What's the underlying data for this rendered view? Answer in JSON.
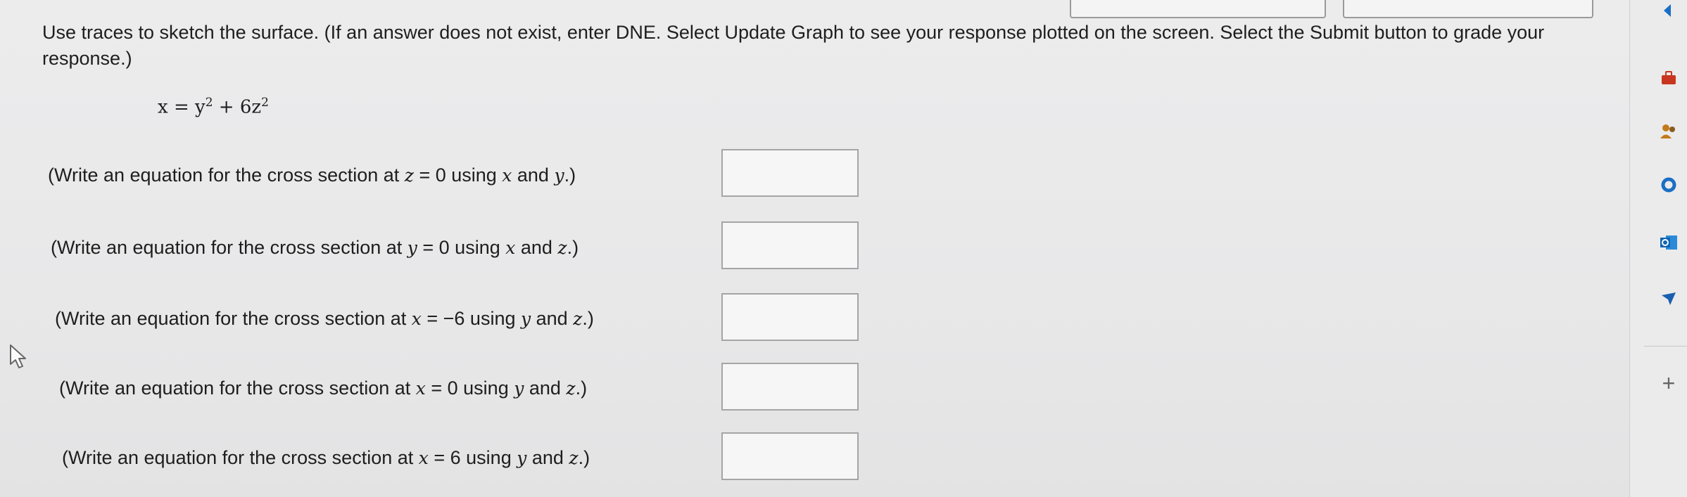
{
  "instructions": "Use traces to sketch the surface. (If an answer does not exist, enter DNE. Select Update Graph to see your response plotted on the screen. Select the Submit button to grade your response.)",
  "equation": {
    "lhs": "x",
    "eq": "=",
    "y": "y",
    "exp2": "2",
    "plus": "+",
    "coef": "6z",
    "exp2b": "2"
  },
  "questions": [
    {
      "pre": "(Write an equation for the cross section at ",
      "var": "z",
      "mid": " = 0 using ",
      "v1": "x",
      "and": " and ",
      "v2": "y",
      "post": ".)",
      "answer": ""
    },
    {
      "pre": "(Write an equation for the cross section at ",
      "var": "y",
      "mid": " = 0 using ",
      "v1": "x",
      "and": " and ",
      "v2": "z",
      "post": ".)",
      "answer": ""
    },
    {
      "pre": "(Write an equation for the cross section at ",
      "var": "x",
      "mid": " = −6 using ",
      "v1": "y",
      "and": " and ",
      "v2": "z",
      "post": ".)",
      "answer": ""
    },
    {
      "pre": "(Write an equation for the cross section at ",
      "var": "x",
      "mid": " = 0 using ",
      "v1": "y",
      "and": " and ",
      "v2": "z",
      "post": ".)",
      "answer": ""
    },
    {
      "pre": "(Write an equation for the cross section at ",
      "var": "x",
      "mid": " = 6 using ",
      "v1": "y",
      "and": " and ",
      "v2": "z",
      "post": ".)",
      "answer": ""
    }
  ],
  "sidebar": {
    "plus": "+",
    "icons": [
      "briefcase-icon",
      "people-icon",
      "circle-icon",
      "outlook-icon",
      "send-icon",
      "plus-icon"
    ]
  },
  "colors": {
    "accent_blue": "#1a6fc4",
    "brand_red": "#c8361f",
    "outlook_blue": "#0f64b4"
  }
}
